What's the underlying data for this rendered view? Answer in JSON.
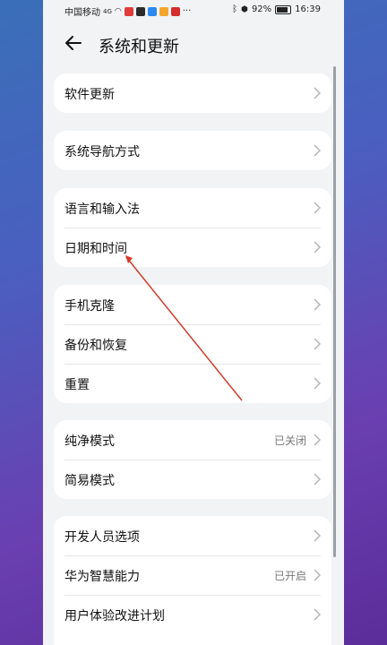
{
  "status_bar": {
    "carrier": "中国移动",
    "network": "4G",
    "battery_percent": "92%",
    "time": "16:39",
    "more": "···"
  },
  "header": {
    "title": "系统和更新"
  },
  "groups": [
    {
      "items": [
        {
          "label": "软件更新",
          "value": ""
        }
      ]
    },
    {
      "items": [
        {
          "label": "系统导航方式",
          "value": ""
        }
      ]
    },
    {
      "items": [
        {
          "label": "语言和输入法",
          "value": ""
        },
        {
          "label": "日期和时间",
          "value": ""
        }
      ]
    },
    {
      "items": [
        {
          "label": "手机克隆",
          "value": ""
        },
        {
          "label": "备份和恢复",
          "value": ""
        },
        {
          "label": "重置",
          "value": ""
        }
      ]
    },
    {
      "items": [
        {
          "label": "纯净模式",
          "value": "已关闭"
        },
        {
          "label": "简易模式",
          "value": ""
        }
      ]
    },
    {
      "items": [
        {
          "label": "开发人员选项",
          "value": ""
        },
        {
          "label": "华为智慧能力",
          "value": "已开启"
        },
        {
          "label": "用户体验改进计划",
          "value": ""
        }
      ]
    }
  ],
  "colors": {
    "background": "#f1f3f5",
    "card": "#ffffff",
    "annotation": "#d23b2a"
  }
}
